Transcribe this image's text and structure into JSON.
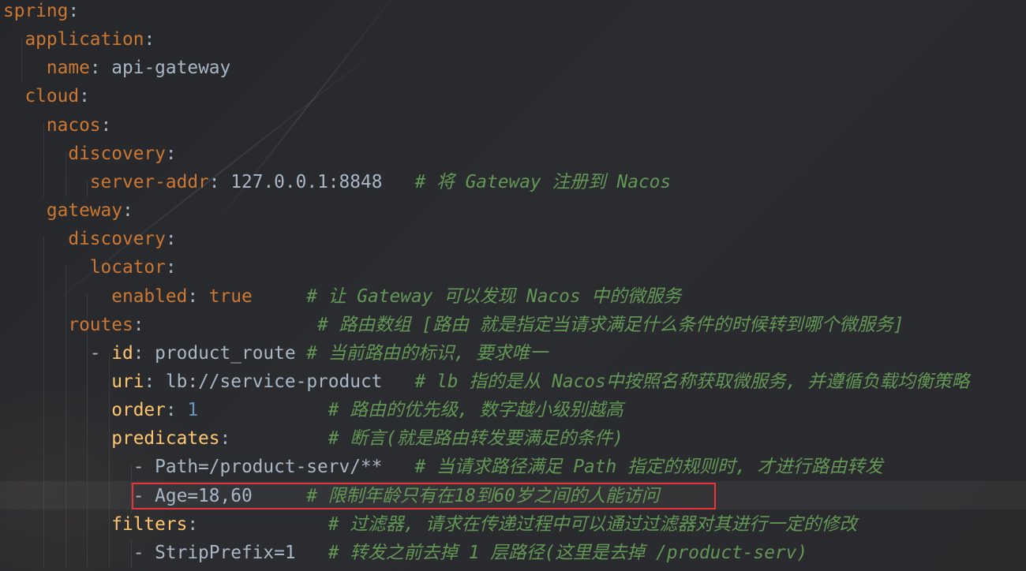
{
  "editor": {
    "language": "yaml",
    "highlighted_line": 17,
    "annotation_box_color": "#e8333a",
    "lines": [
      {
        "indent": "",
        "key": "spring",
        "key_style": "k",
        "value": "",
        "value_style": "v",
        "pad": "",
        "comment": ""
      },
      {
        "indent": "  ",
        "key": "application",
        "key_style": "k",
        "value": "",
        "value_style": "v",
        "pad": "",
        "comment": ""
      },
      {
        "indent": "    ",
        "key": "name",
        "key_style": "k",
        "value": "api-gateway",
        "value_style": "v",
        "pad": "",
        "comment": ""
      },
      {
        "indent": "  ",
        "key": "cloud",
        "key_style": "k",
        "value": "",
        "value_style": "v",
        "pad": "",
        "comment": ""
      },
      {
        "indent": "    ",
        "key": "nacos",
        "key_style": "k",
        "value": "",
        "value_style": "v",
        "pad": "",
        "comment": ""
      },
      {
        "indent": "      ",
        "key": "discovery",
        "key_style": "k",
        "value": "",
        "value_style": "v",
        "pad": "",
        "comment": ""
      },
      {
        "indent": "        ",
        "key": "server-addr",
        "key_style": "k",
        "value": "127.0.0.1:8848",
        "value_style": "v",
        "pad": "   ",
        "comment": "# 将 Gateway 注册到 Nacos"
      },
      {
        "indent": "    ",
        "key": "gateway",
        "key_style": "k",
        "value": "",
        "value_style": "v",
        "pad": "",
        "comment": ""
      },
      {
        "indent": "      ",
        "key": "discovery",
        "key_style": "k",
        "value": "",
        "value_style": "v",
        "pad": "",
        "comment": ""
      },
      {
        "indent": "        ",
        "key": "locator",
        "key_style": "k",
        "value": "",
        "value_style": "v",
        "pad": "",
        "comment": ""
      },
      {
        "indent": "          ",
        "key": "enabled",
        "key_style": "k",
        "value": "true",
        "value_style": "k",
        "pad": "     ",
        "comment": "# 让 Gateway 可以发现 Nacos 中的微服务"
      },
      {
        "indent": "      ",
        "key": "routes",
        "key_style": "k",
        "value": "",
        "value_style": "v",
        "pad": "                ",
        "comment": "# 路由数组 [路由 就是指定当请求满足什么条件的时候转到哪个微服务]"
      },
      {
        "indent": "        - ",
        "key": "id",
        "key_style": "k2",
        "value": "product_route",
        "value_style": "v",
        "pad": " ",
        "comment": "# 当前路由的标识, 要求唯一"
      },
      {
        "indent": "          ",
        "key": "uri",
        "key_style": "k2",
        "value": "lb://service-product",
        "value_style": "v",
        "pad": "   ",
        "comment": "# lb 指的是从 Nacos中按照名称获取微服务, 并遵循负载均衡策略"
      },
      {
        "indent": "          ",
        "key": "order",
        "key_style": "k2",
        "value": "1",
        "value_style": "n",
        "pad": "            ",
        "comment": "# 路由的优先级, 数字越小级别越高"
      },
      {
        "indent": "          ",
        "key": "predicates",
        "key_style": "k2",
        "value": "",
        "value_style": "v",
        "pad": "         ",
        "comment": "# 断言(就是路由转发要满足的条件)"
      },
      {
        "indent": "            - ",
        "key": "",
        "key_style": "k2",
        "value": "Path=/product-serv/**",
        "value_style": "v",
        "pad": "   ",
        "comment": "# 当请求路径满足 Path 指定的规则时, 才进行路由转发"
      },
      {
        "indent": "            - ",
        "key": "",
        "key_style": "k2",
        "value": "Age=18,60",
        "value_style": "v",
        "pad": "     ",
        "comment": "# 限制年龄只有在18到60岁之间的人能访问"
      },
      {
        "indent": "          ",
        "key": "filters",
        "key_style": "k2",
        "value": "",
        "value_style": "v",
        "pad": "            ",
        "comment": "# 过滤器, 请求在传递过程中可以通过过滤器对其进行一定的修改"
      },
      {
        "indent": "            - ",
        "key": "",
        "key_style": "k2",
        "value": "StripPrefix=1",
        "value_style": "v",
        "pad": "   ",
        "comment": "# 转发之前去掉 1 层路径(这里是去掉 /product-serv)"
      }
    ]
  }
}
